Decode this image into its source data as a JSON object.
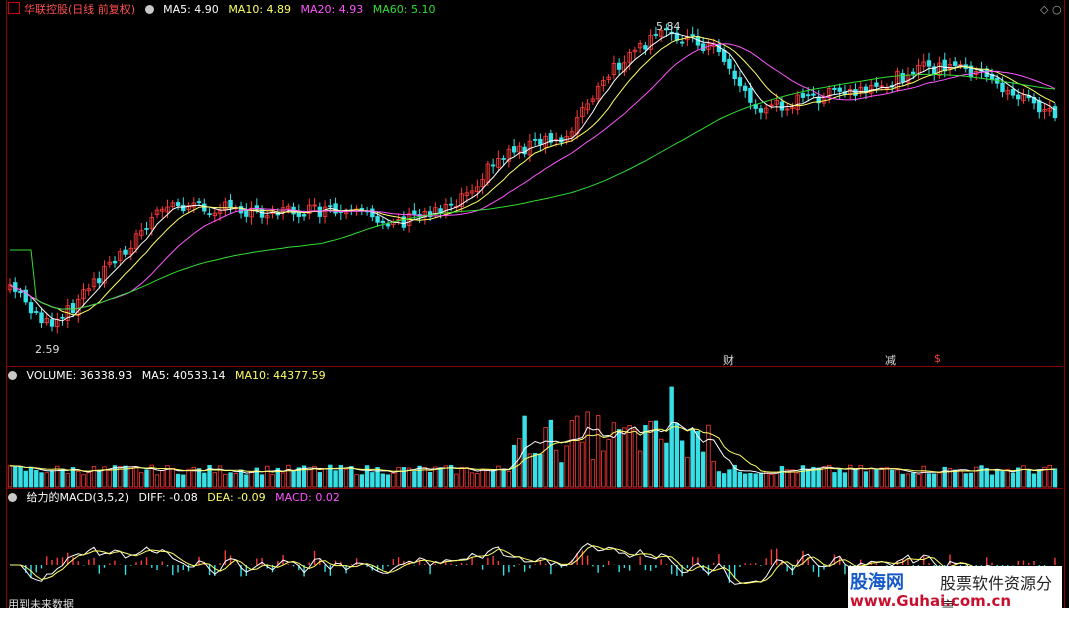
{
  "main_header": {
    "title": "华联控股(日线 前复权)",
    "ma5": "MA5: 4.90",
    "ma10": "MA10: 4.89",
    "ma20": "MA20: 4.93",
    "ma60": "MA60: 5.10"
  },
  "main_labels": {
    "high": "5.84",
    "low": "2.59",
    "event1": "财",
    "event2": "减",
    "event3": "$"
  },
  "volume_header": {
    "title": "VOLUME: 36338.93",
    "ma5": "MA5: 40533.14",
    "ma10": "MA10: 44377.59"
  },
  "macd_header": {
    "title": "给力的MACD(3,5,2)",
    "diff": "DIFF: -0.08",
    "dea": "DEA: -0.09",
    "macd": "MACD: 0.02"
  },
  "bottom_left": "用到未来数据",
  "watermark": {
    "line1": "股海网",
    "line2": "股票软件资源分享",
    "line3": "www.Guhai.com.cn"
  },
  "colors": {
    "up": "#ff3a3a",
    "down": "#37e0e6",
    "ma5": "#ffffff",
    "ma10": "#ffff66",
    "ma20": "#ff55ff",
    "ma60": "#33dd33",
    "border": "#8b0000"
  }
}
